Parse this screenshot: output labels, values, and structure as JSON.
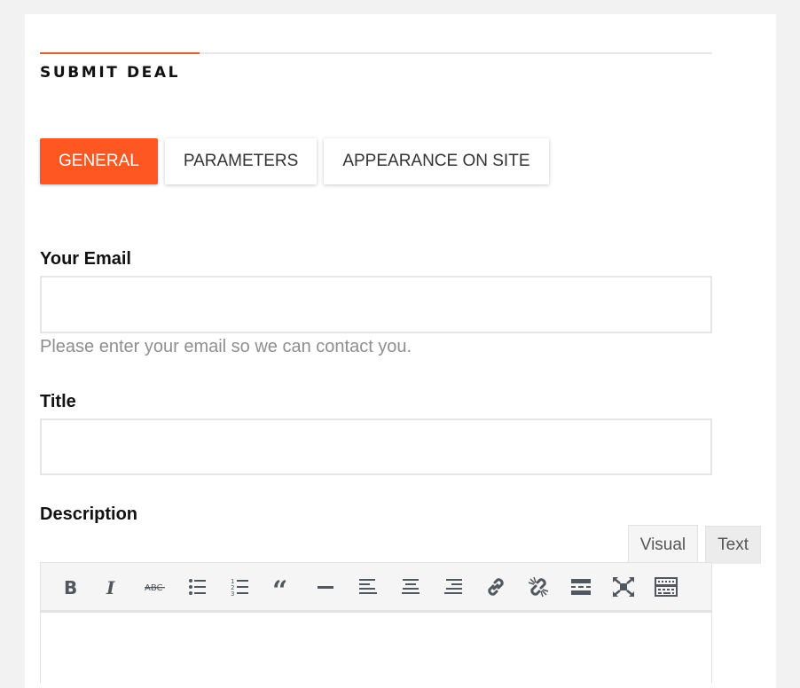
{
  "page": {
    "heading": "SUBMIT DEAL",
    "accent_color": "#ff5722"
  },
  "tabs": [
    {
      "label": "GENERAL",
      "active": true
    },
    {
      "label": "PARAMETERS",
      "active": false
    },
    {
      "label": "APPEARANCE ON SITE",
      "active": false
    }
  ],
  "fields": {
    "email": {
      "label": "Your Email",
      "value": "",
      "placeholder": "",
      "help": "Please enter your email so we can contact you."
    },
    "title": {
      "label": "Title",
      "value": "",
      "placeholder": ""
    },
    "description": {
      "label": "Description",
      "editor_tabs": [
        {
          "label": "Visual",
          "active": true
        },
        {
          "label": "Text",
          "active": false
        }
      ],
      "toolbar": [
        {
          "name": "bold-icon",
          "title": "Bold"
        },
        {
          "name": "italic-icon",
          "title": "Italic"
        },
        {
          "name": "strikethrough-icon",
          "title": "Strikethrough"
        },
        {
          "name": "bulleted-list-icon",
          "title": "Bulleted list"
        },
        {
          "name": "numbered-list-icon",
          "title": "Numbered list"
        },
        {
          "name": "blockquote-icon",
          "title": "Blockquote"
        },
        {
          "name": "horizontal-line-icon",
          "title": "Horizontal line"
        },
        {
          "name": "align-left-icon",
          "title": "Align left"
        },
        {
          "name": "align-center-icon",
          "title": "Align center"
        },
        {
          "name": "align-right-icon",
          "title": "Align right"
        },
        {
          "name": "link-icon",
          "title": "Insert/edit link"
        },
        {
          "name": "unlink-icon",
          "title": "Remove link"
        },
        {
          "name": "read-more-icon",
          "title": "Insert Read More tag"
        },
        {
          "name": "fullscreen-icon",
          "title": "Fullscreen"
        },
        {
          "name": "toolbar-toggle-icon",
          "title": "Toolbar Toggle"
        }
      ]
    }
  }
}
